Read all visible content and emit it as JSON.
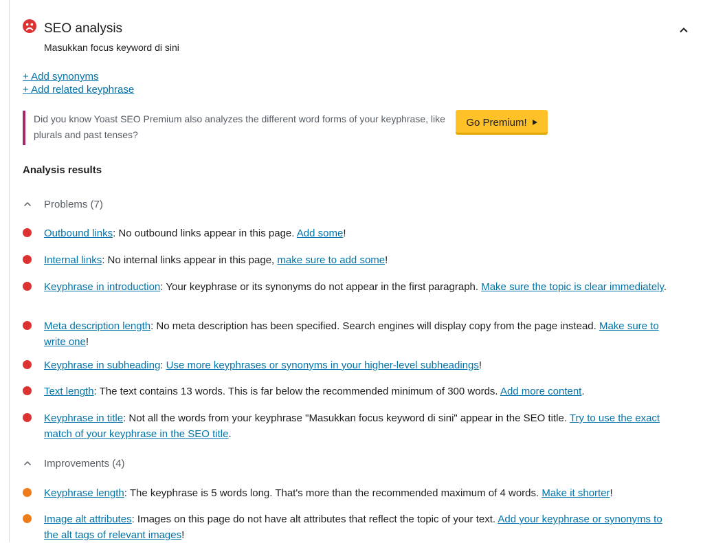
{
  "header": {
    "title": "SEO analysis",
    "subtitle": "Masukkan focus keyword di sini",
    "status_icon": "sad-face-icon",
    "status_color": "#dc3232",
    "collapse_icon": "chevron-up-icon"
  },
  "links": {
    "synonyms": "+ Add synonyms",
    "related": "+ Add related keyphrase"
  },
  "premium": {
    "text": "Did you know Yoast SEO Premium also analyzes the different word forms of your keyphrase, like plurals and past tenses?",
    "button": "Go Premium!",
    "button_color": "#fec228",
    "bar_color": "#a4286a"
  },
  "analysis": {
    "heading": "Analysis results",
    "problems": {
      "label": "Problems (7)",
      "color": "#dc3232",
      "items": [
        {
          "link": "Outbound links",
          "text": ": No outbound links appear in this page. ",
          "action": "Add some",
          "tail": "!"
        },
        {
          "link": "Internal links",
          "text": ": No internal links appear in this page, ",
          "action": "make sure to add some",
          "tail": "!"
        },
        {
          "link": "Keyphrase in introduction",
          "text": ": Your keyphrase or its synonyms do not appear in the first paragraph. ",
          "action": "Make sure the topic is clear immediately",
          "tail": "."
        },
        {
          "link": "Meta description length",
          "text": ": No meta description has been specified. Search engines will display copy from the page instead. ",
          "action": "Make sure to write one",
          "tail": "!"
        },
        {
          "link": "Keyphrase in subheading",
          "text": ": ",
          "action": "Use more keyphrases or synonyms in your higher-level subheadings",
          "tail": "!"
        },
        {
          "link": "Text length",
          "text": ": The text contains 13 words. This is far below the recommended minimum of 300 words. ",
          "action": "Add more content",
          "tail": "."
        },
        {
          "link": "Keyphrase in title",
          "text": ": Not all the words from your keyphrase \"Masukkan focus keyword di sini\" appear in the SEO title. ",
          "action": "Try to use the exact match of your keyphrase in the SEO title",
          "tail": "."
        }
      ]
    },
    "improvements": {
      "label": "Improvements (4)",
      "color": "#ee7c1b",
      "items": [
        {
          "link": "Keyphrase length",
          "text": ": The keyphrase is 5 words long. That's more than the recommended maximum of 4 words. ",
          "action": "Make it shorter",
          "tail": "!"
        },
        {
          "link": "Image alt attributes",
          "text": ": Images on this page do not have alt attributes that reflect the topic of your text. ",
          "action": "Add your keyphrase or synonyms to the alt tags of relevant images",
          "tail": "!"
        }
      ]
    }
  }
}
